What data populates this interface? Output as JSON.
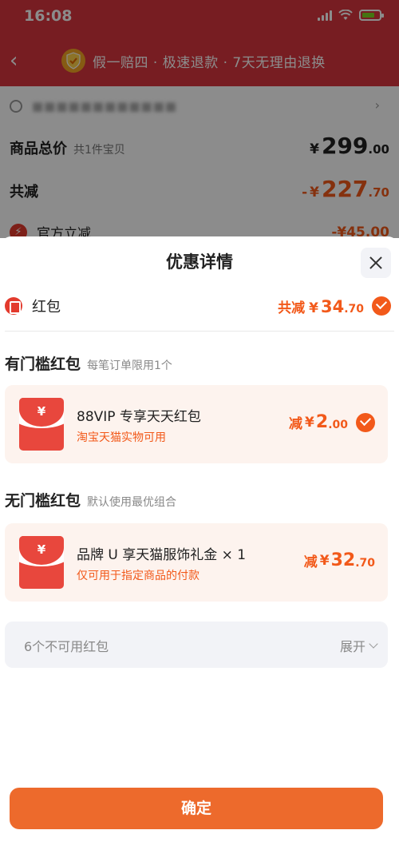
{
  "status_bar": {
    "time": "16:08"
  },
  "nav": {
    "guarantee_text": "假一赔四 · 极速退款 · 7天无理由退换"
  },
  "order": {
    "address_masked": "■■■■■■■■■■■■",
    "total_label": "商品总价",
    "total_count": "共1件宝贝",
    "total_currency": "¥",
    "total_int": "299",
    "total_dec": ".00",
    "discount_label": "共减",
    "discount_prefix": "-",
    "discount_currency": "¥",
    "discount_int": "227",
    "discount_dec": ".70",
    "official_label": "官方立减",
    "official_value": "-¥45.00"
  },
  "sheet": {
    "title": "优惠详情",
    "hongbao_label": "红包",
    "hongbao_total_prefix": "共减",
    "hongbao_total_currency": "¥",
    "hongbao_total_int": "34",
    "hongbao_total_dec": ".70",
    "threshold_title": "有门槛红包",
    "threshold_sub": "每笔订单限用1个",
    "no_threshold_title": "无门槛红包",
    "no_threshold_sub": "默认使用最优组合",
    "coupons": [
      {
        "yen": "¥",
        "name": "88VIP 专享天天红包",
        "desc": "淘宝天猫实物可用",
        "prefix": "减",
        "currency": "¥",
        "int": "2",
        "dec": ".00"
      },
      {
        "yen": "¥",
        "name": "品牌 U 享天猫服饰礼金 × 1",
        "desc": "仅可用于指定商品的付款",
        "prefix": "减",
        "currency": "¥",
        "int": "32",
        "dec": ".70"
      }
    ],
    "unavailable_text": "6个不可用红包",
    "expand_label": "展开",
    "confirm_label": "确定"
  },
  "colors": {
    "header_red": "#d9363e",
    "accent_orange": "#f2591a",
    "confirm_orange": "#ed6a2c"
  }
}
